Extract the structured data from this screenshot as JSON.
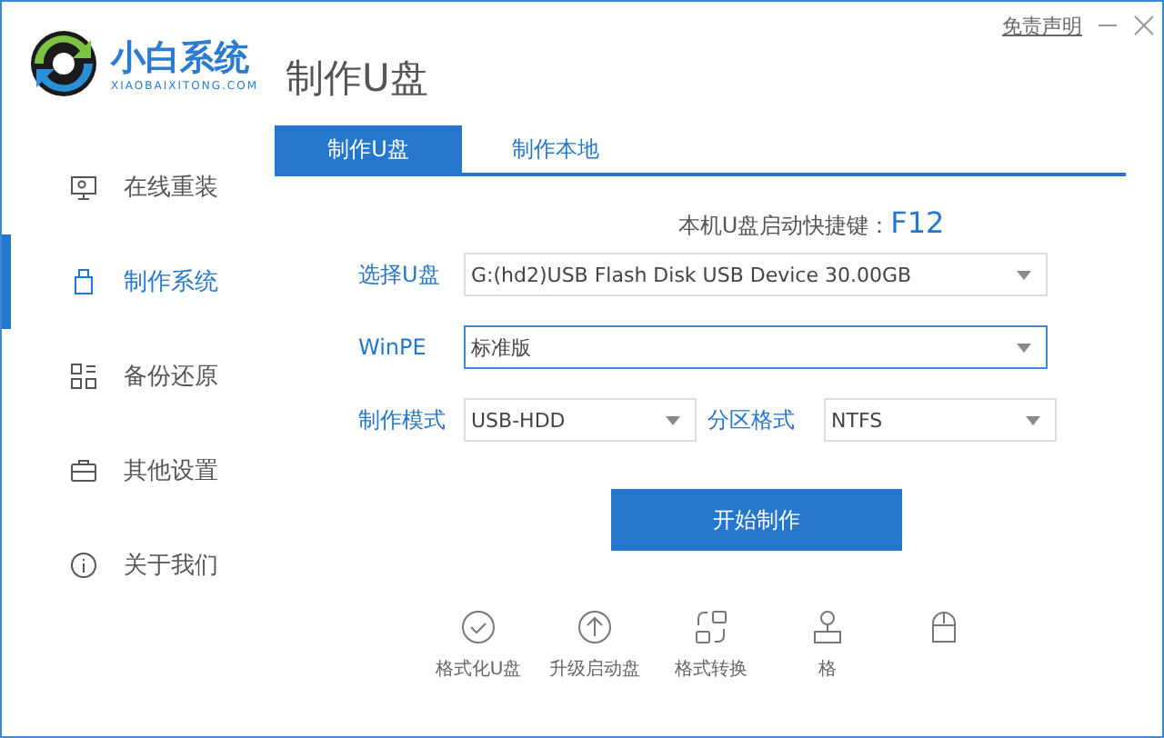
{
  "app": {
    "name": "小白系统",
    "domain": "XIAOBAIXITONG.COM"
  },
  "window": {
    "disclaimer": "免责声明"
  },
  "page_title": "制作U盘",
  "sidebar": {
    "items": [
      {
        "label": "在线重装",
        "selected": false
      },
      {
        "label": "制作系统",
        "selected": true
      },
      {
        "label": "备份还原",
        "selected": false
      },
      {
        "label": "其他设置",
        "selected": false
      },
      {
        "label": "关于我们",
        "selected": false
      }
    ]
  },
  "tabs": [
    {
      "label": "制作U盘",
      "selected": true
    },
    {
      "label": "制作本地",
      "selected": false
    }
  ],
  "hotkey": {
    "label": "本机U盘启动快捷键：",
    "value": "F12"
  },
  "fields": [
    {
      "label": "选择U盘",
      "value": "G:(hd2)USB Flash Disk USB Device 30.00GB",
      "focused": false
    },
    {
      "label": "WinPE",
      "value": "标准版",
      "focused": true
    },
    {
      "label": "制作模式",
      "value": "USB-HDD",
      "focused": false
    },
    {
      "label": "分区格式",
      "value": "NTFS",
      "focused": false
    }
  ],
  "start_button": "开始制作",
  "tools": [
    {
      "label": "格式化U盘"
    },
    {
      "label": "升级启动盘"
    },
    {
      "label": "格式转换"
    },
    {
      "label": "格"
    }
  ]
}
